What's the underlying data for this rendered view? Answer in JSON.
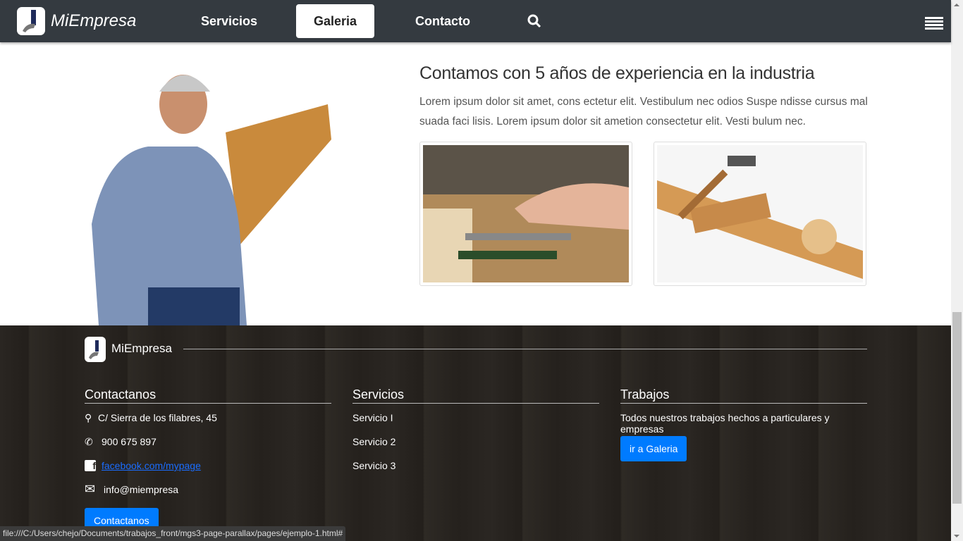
{
  "nav": {
    "brand": "MiEmpresa",
    "items": [
      {
        "label": "Servicios"
      },
      {
        "label": "Galeria",
        "active": true
      },
      {
        "label": "Contacto"
      }
    ],
    "search_icon": "search-icon",
    "menu_icon": "hamburger-icon"
  },
  "main": {
    "heading": "Contamos con 5 años de experiencia en la industria",
    "text": "Lorem ipsum dolor sit amet, cons ectetur elit. Vestibulum nec odios Suspe ndisse cursus mal suada faci lisis. Lorem ipsum dolor sit ametion consectetur elit. Vesti bulum nec."
  },
  "footer": {
    "brand": "MiEmpresa",
    "contact": {
      "title": "Contactanos",
      "address": "C/ Sierra de los filabres, 45",
      "phone": "900 675 897",
      "facebook": "facebook.com/mypage",
      "email": "info@miempresa",
      "button": "Contactanos"
    },
    "services": {
      "title": "Servicios",
      "items": [
        "Servicio I",
        "Servicio 2",
        "Servicio 3"
      ]
    },
    "works": {
      "title": "Trabajos",
      "text": "Todos nuestros trabajos hechos a particulares y empresas",
      "button": "ir a Galeria"
    }
  },
  "status_url": "file:///C:/Users/chejo/Documents/trabajos_front/mgs3-page-parallax/pages/ejemplo-1.html#",
  "colors": {
    "nav": "#343a40",
    "accent": "#007bff",
    "link": "#1a6dff"
  }
}
